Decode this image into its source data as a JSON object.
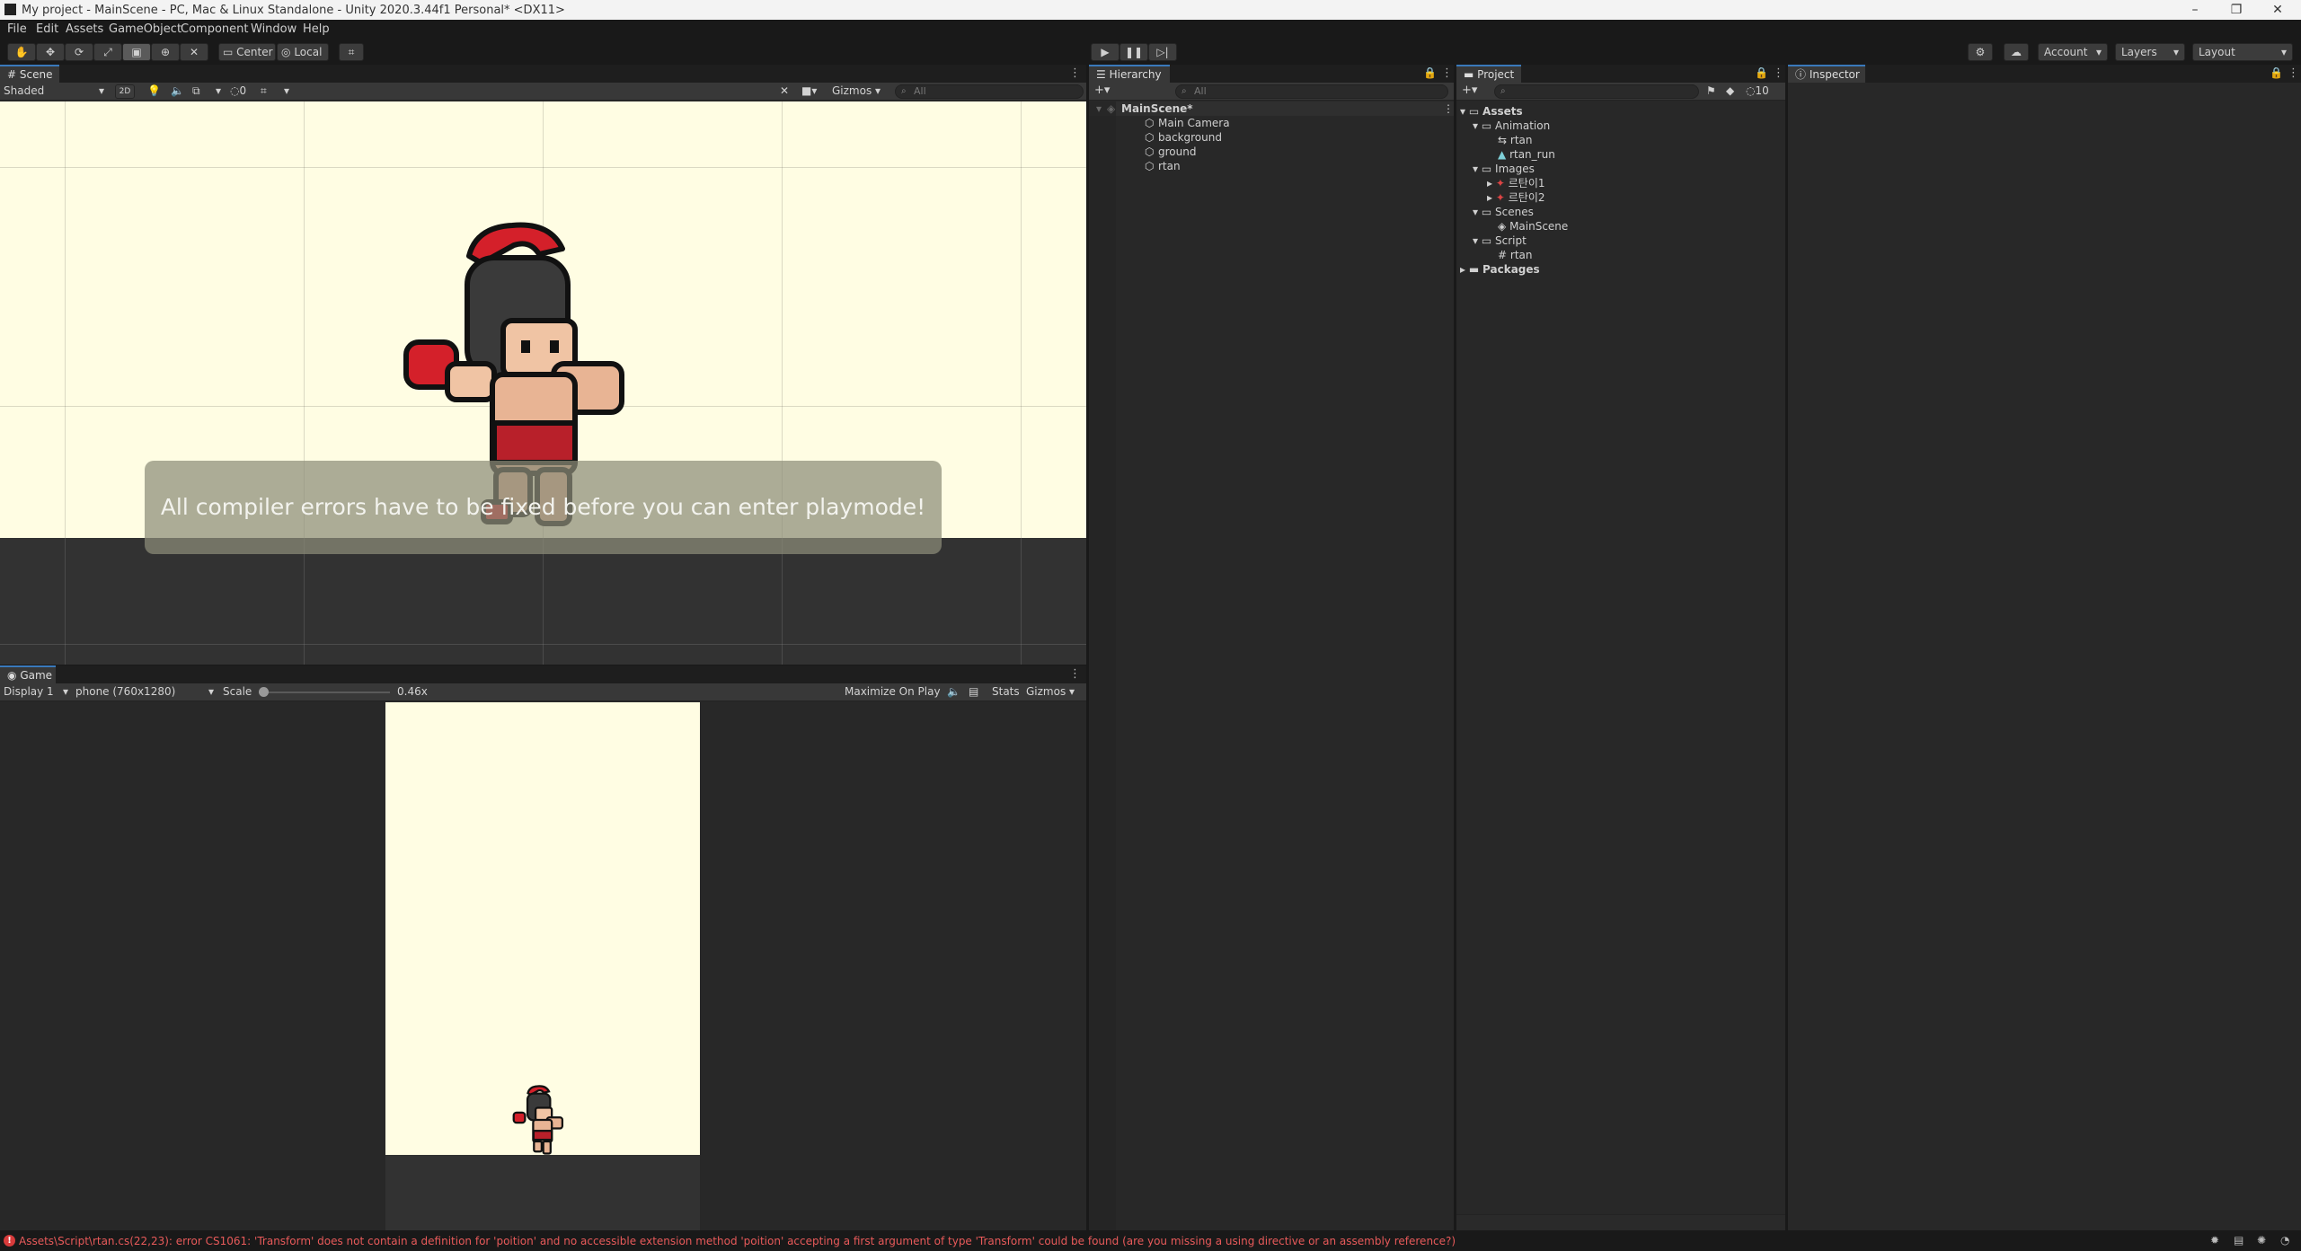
{
  "window": {
    "title": "My project - MainScene - PC, Mac & Linux Standalone - Unity 2020.3.44f1 Personal* <DX11>"
  },
  "menu": [
    "File",
    "Edit",
    "Assets",
    "GameObject",
    "Component",
    "Window",
    "Help"
  ],
  "toolbar": {
    "pivot": "Center",
    "space": "Local",
    "account": "Account",
    "layers": "Layers",
    "layout": "Layout"
  },
  "scene": {
    "tab": "Scene",
    "shading": "Shaded",
    "mode_2d": "2D",
    "hidden_count": "0",
    "gizmos": "Gizmos",
    "search_placeholder": "All",
    "notification": "All compiler errors have to be fixed before you can enter playmode!"
  },
  "game": {
    "tab": "Game",
    "display": "Display 1",
    "resolution": "phone (760x1280)",
    "scale_label": "Scale",
    "scale_value": "0.46x",
    "scale_level": 0.0,
    "maximize": "Maximize On Play",
    "stats": "Stats",
    "gizmos": "Gizmos"
  },
  "hierarchy": {
    "tab": "Hierarchy",
    "search_placeholder": "All",
    "scene_name": "MainScene*",
    "items": [
      "Main Camera",
      "background",
      "ground",
      "rtan"
    ]
  },
  "project": {
    "tab": "Project",
    "hidden_count": "10",
    "root": "Assets",
    "animation_folder": "Animation",
    "animation_items": [
      "rtan",
      "rtan_run"
    ],
    "images_folder": "Images",
    "images_items": [
      "르탄이1",
      "르탄이2"
    ],
    "scenes_folder": "Scenes",
    "scenes_items": [
      "MainScene"
    ],
    "script_folder": "Script",
    "script_items": [
      "rtan"
    ],
    "packages": "Packages"
  },
  "inspector": {
    "tab": "Inspector"
  },
  "status": {
    "error": "Assets\\Script\\rtan.cs(22,23): error CS1061: 'Transform' does not contain a definition for 'poition' and no accessible extension method 'poition' accepting a first argument of type 'Transform' could be found (are you missing a using directive or an assembly reference?)",
    "error_color": "#e85a5a"
  },
  "colors": {
    "accent": "#3a79bb",
    "scene_bg": "#fffde3",
    "ground": "#323232"
  }
}
